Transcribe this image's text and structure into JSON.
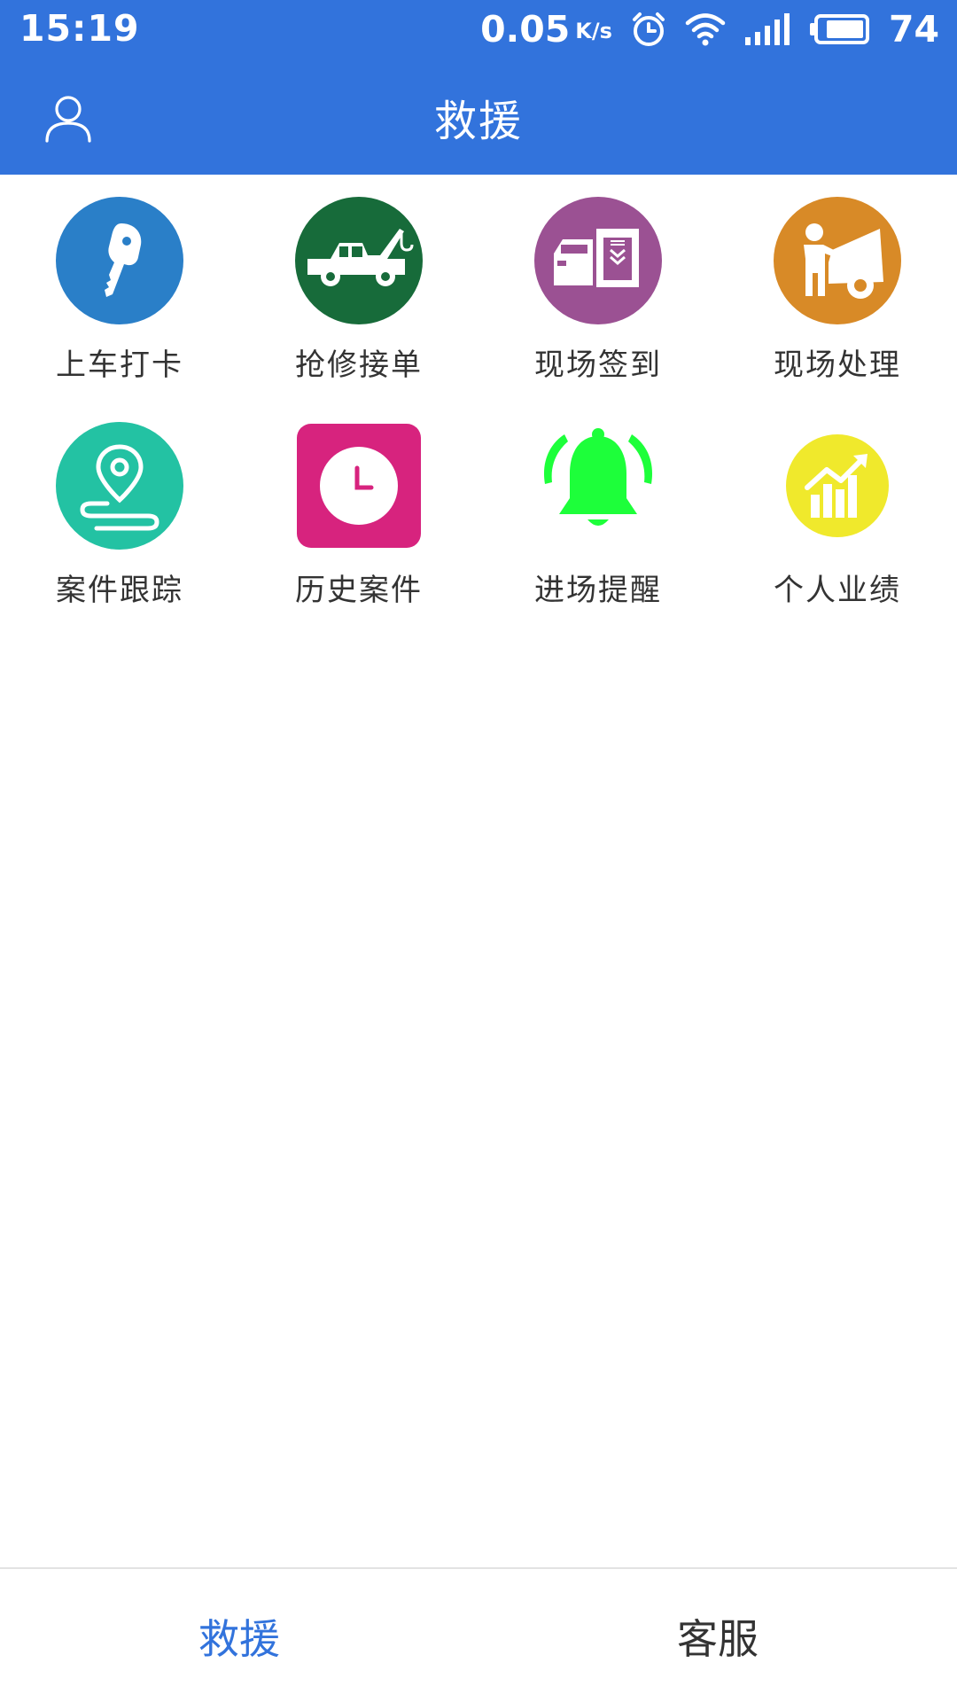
{
  "status_bar": {
    "time": "15:19",
    "net_speed": "0.05",
    "net_speed_unit": "K/s",
    "battery_level": "74",
    "icons": [
      "alarm-icon",
      "wifi-icon",
      "signal-icon",
      "battery-icon"
    ]
  },
  "header": {
    "title": "救援",
    "profile_icon": "user-icon"
  },
  "colors": {
    "brand": "#3273dc",
    "text": "#333333"
  },
  "grid": {
    "items": [
      {
        "label": "上车打卡",
        "icon": "car-key-icon",
        "color": "#2a7fc8"
      },
      {
        "label": "抢修接单",
        "icon": "tow-truck-icon",
        "color": "#176b3a"
      },
      {
        "label": "现场签到",
        "icon": "car-checkin-icon",
        "color": "#9b5193"
      },
      {
        "label": "现场处理",
        "icon": "mechanic-repair-icon",
        "color": "#d88a27"
      },
      {
        "label": "案件跟踪",
        "icon": "location-track-icon",
        "color": "#23c2a3"
      },
      {
        "label": "历史案件",
        "icon": "clock-icon",
        "color": "#d7237e"
      },
      {
        "label": "进场提醒",
        "icon": "bell-icon",
        "color": "#1dff3a"
      },
      {
        "label": "个人业绩",
        "icon": "performance-chart-icon",
        "color": "#f0e92c"
      }
    ]
  },
  "tabs": [
    {
      "label": "救援",
      "active": true
    },
    {
      "label": "客服",
      "active": false
    }
  ]
}
